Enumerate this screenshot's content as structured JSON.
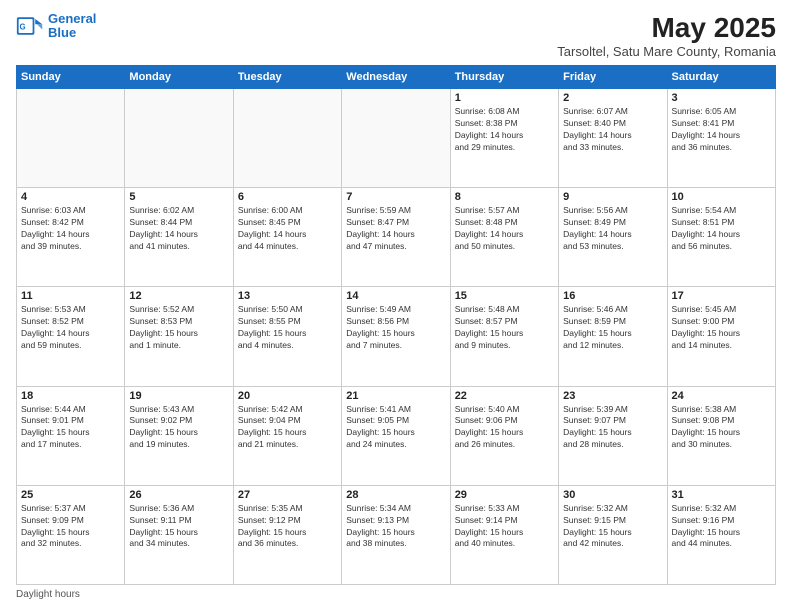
{
  "header": {
    "logo_line1": "General",
    "logo_line2": "Blue",
    "title": "May 2025",
    "subtitle": "Tarsoltel, Satu Mare County, Romania"
  },
  "days_of_week": [
    "Sunday",
    "Monday",
    "Tuesday",
    "Wednesday",
    "Thursday",
    "Friday",
    "Saturday"
  ],
  "weeks": [
    [
      {
        "day": "",
        "info": ""
      },
      {
        "day": "",
        "info": ""
      },
      {
        "day": "",
        "info": ""
      },
      {
        "day": "",
        "info": ""
      },
      {
        "day": "1",
        "info": "Sunrise: 6:08 AM\nSunset: 8:38 PM\nDaylight: 14 hours\nand 29 minutes."
      },
      {
        "day": "2",
        "info": "Sunrise: 6:07 AM\nSunset: 8:40 PM\nDaylight: 14 hours\nand 33 minutes."
      },
      {
        "day": "3",
        "info": "Sunrise: 6:05 AM\nSunset: 8:41 PM\nDaylight: 14 hours\nand 36 minutes."
      }
    ],
    [
      {
        "day": "4",
        "info": "Sunrise: 6:03 AM\nSunset: 8:42 PM\nDaylight: 14 hours\nand 39 minutes."
      },
      {
        "day": "5",
        "info": "Sunrise: 6:02 AM\nSunset: 8:44 PM\nDaylight: 14 hours\nand 41 minutes."
      },
      {
        "day": "6",
        "info": "Sunrise: 6:00 AM\nSunset: 8:45 PM\nDaylight: 14 hours\nand 44 minutes."
      },
      {
        "day": "7",
        "info": "Sunrise: 5:59 AM\nSunset: 8:47 PM\nDaylight: 14 hours\nand 47 minutes."
      },
      {
        "day": "8",
        "info": "Sunrise: 5:57 AM\nSunset: 8:48 PM\nDaylight: 14 hours\nand 50 minutes."
      },
      {
        "day": "9",
        "info": "Sunrise: 5:56 AM\nSunset: 8:49 PM\nDaylight: 14 hours\nand 53 minutes."
      },
      {
        "day": "10",
        "info": "Sunrise: 5:54 AM\nSunset: 8:51 PM\nDaylight: 14 hours\nand 56 minutes."
      }
    ],
    [
      {
        "day": "11",
        "info": "Sunrise: 5:53 AM\nSunset: 8:52 PM\nDaylight: 14 hours\nand 59 minutes."
      },
      {
        "day": "12",
        "info": "Sunrise: 5:52 AM\nSunset: 8:53 PM\nDaylight: 15 hours\nand 1 minute."
      },
      {
        "day": "13",
        "info": "Sunrise: 5:50 AM\nSunset: 8:55 PM\nDaylight: 15 hours\nand 4 minutes."
      },
      {
        "day": "14",
        "info": "Sunrise: 5:49 AM\nSunset: 8:56 PM\nDaylight: 15 hours\nand 7 minutes."
      },
      {
        "day": "15",
        "info": "Sunrise: 5:48 AM\nSunset: 8:57 PM\nDaylight: 15 hours\nand 9 minutes."
      },
      {
        "day": "16",
        "info": "Sunrise: 5:46 AM\nSunset: 8:59 PM\nDaylight: 15 hours\nand 12 minutes."
      },
      {
        "day": "17",
        "info": "Sunrise: 5:45 AM\nSunset: 9:00 PM\nDaylight: 15 hours\nand 14 minutes."
      }
    ],
    [
      {
        "day": "18",
        "info": "Sunrise: 5:44 AM\nSunset: 9:01 PM\nDaylight: 15 hours\nand 17 minutes."
      },
      {
        "day": "19",
        "info": "Sunrise: 5:43 AM\nSunset: 9:02 PM\nDaylight: 15 hours\nand 19 minutes."
      },
      {
        "day": "20",
        "info": "Sunrise: 5:42 AM\nSunset: 9:04 PM\nDaylight: 15 hours\nand 21 minutes."
      },
      {
        "day": "21",
        "info": "Sunrise: 5:41 AM\nSunset: 9:05 PM\nDaylight: 15 hours\nand 24 minutes."
      },
      {
        "day": "22",
        "info": "Sunrise: 5:40 AM\nSunset: 9:06 PM\nDaylight: 15 hours\nand 26 minutes."
      },
      {
        "day": "23",
        "info": "Sunrise: 5:39 AM\nSunset: 9:07 PM\nDaylight: 15 hours\nand 28 minutes."
      },
      {
        "day": "24",
        "info": "Sunrise: 5:38 AM\nSunset: 9:08 PM\nDaylight: 15 hours\nand 30 minutes."
      }
    ],
    [
      {
        "day": "25",
        "info": "Sunrise: 5:37 AM\nSunset: 9:09 PM\nDaylight: 15 hours\nand 32 minutes."
      },
      {
        "day": "26",
        "info": "Sunrise: 5:36 AM\nSunset: 9:11 PM\nDaylight: 15 hours\nand 34 minutes."
      },
      {
        "day": "27",
        "info": "Sunrise: 5:35 AM\nSunset: 9:12 PM\nDaylight: 15 hours\nand 36 minutes."
      },
      {
        "day": "28",
        "info": "Sunrise: 5:34 AM\nSunset: 9:13 PM\nDaylight: 15 hours\nand 38 minutes."
      },
      {
        "day": "29",
        "info": "Sunrise: 5:33 AM\nSunset: 9:14 PM\nDaylight: 15 hours\nand 40 minutes."
      },
      {
        "day": "30",
        "info": "Sunrise: 5:32 AM\nSunset: 9:15 PM\nDaylight: 15 hours\nand 42 minutes."
      },
      {
        "day": "31",
        "info": "Sunrise: 5:32 AM\nSunset: 9:16 PM\nDaylight: 15 hours\nand 44 minutes."
      }
    ]
  ],
  "footer": {
    "note": "Daylight hours"
  }
}
